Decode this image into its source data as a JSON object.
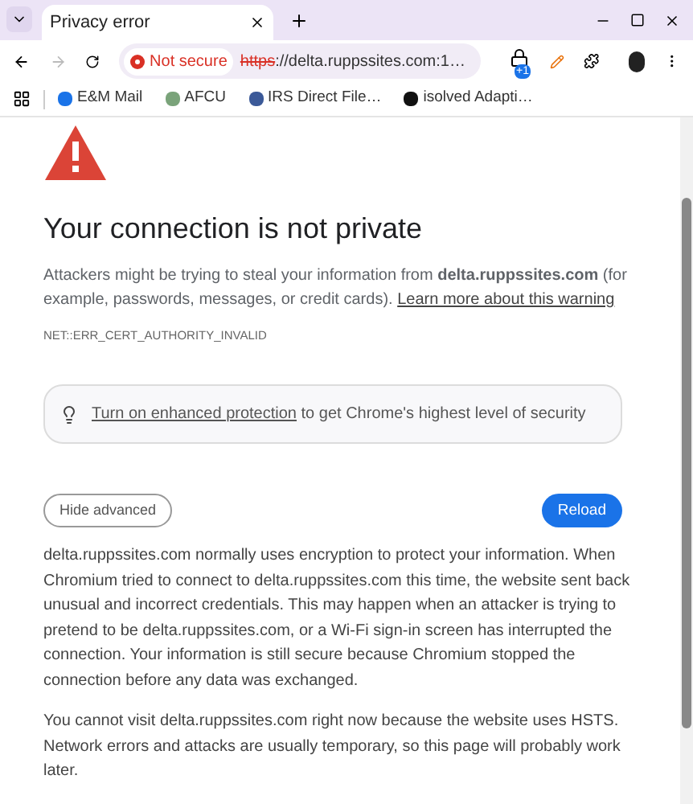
{
  "browser": {
    "tabs": [
      {
        "title": "Privacy error",
        "selected": true
      }
    ],
    "security_chip": "Not secure",
    "url": {
      "scheme": "https",
      "rest": "://delta.ruppssites.com:1…"
    },
    "extension_badge": "+1",
    "bookmarks": [
      {
        "label": "E&M Mail",
        "color": "#1a73e8"
      },
      {
        "label": "AFCU",
        "color": "#7aa37a"
      },
      {
        "label": "IRS Direct File…",
        "color": "#3b5998"
      },
      {
        "label": "isolved Adapti…",
        "color": "#111111"
      }
    ]
  },
  "page": {
    "title": "Your connection is not private",
    "description": "Attackers might be trying to steal your information from **delta.ruppssites.com** (for example, passwords, messages, or credit cards).",
    "learn_more_link": "Learn more about this warning",
    "error_code": "NET::ERR_CERT_AUTHORITY_INVALID",
    "protection_link": "Turn on enhanced protection",
    "protection_text": "to get Chrome's highest level of security",
    "buttons": {
      "advanced": "Hide advanced",
      "reload": "Reload"
    },
    "details": [
      "delta.ruppssites.com normally uses encryption to protect your information. When Chromium tried to connect to delta.ruppssites.com this time, the website sent back unusual and incorrect credentials. This may happen when an attacker is trying to pretend to be delta.ruppssites.com, or a Wi-Fi sign-in screen has interrupted the connection. Your information is still secure because Chromium stopped the connection before any data was exchanged.",
      "You cannot visit delta.ruppssites.com right now because the website uses HSTS. Network errors and attacks are usually temporary, so this page will probably work later."
    ]
  }
}
